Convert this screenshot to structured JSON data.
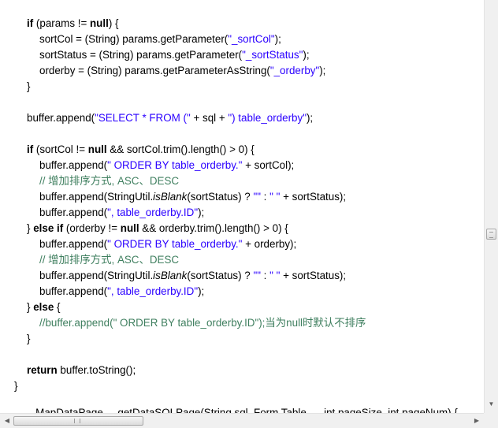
{
  "code": {
    "l1_kw_if": "if",
    "l1_a": " (params != ",
    "l1_kw_null": "null",
    "l1_b": ") {",
    "l2_a": "sortCol = (String) params.getParameter(",
    "l2_str": "\"_sortCol\"",
    "l2_b": ");",
    "l3_a": "sortStatus = (String) params.getParameter(",
    "l3_str": "\"_sortStatus\"",
    "l3_b": ");",
    "l4_a": "orderby = (String) params.getParameterAsString(",
    "l4_str": "\"_orderby\"",
    "l4_b": ");",
    "l5": "}",
    "l6_a": "buffer.append(",
    "l6_str1": "\"SELECT * FROM (\"",
    "l6_b": " + sql + ",
    "l6_str2": "\") table_orderby\"",
    "l6_c": ");",
    "l7_kw_if": "if",
    "l7_a": " (sortCol != ",
    "l7_kw_null": "null",
    "l7_b": " && sortCol.trim().length() > 0) {",
    "l8_a": "buffer.append(",
    "l8_str": "\" ORDER BY table_orderby.\"",
    "l8_b": " + sortCol);",
    "l9_cmt": "// 增加排序方式, ASC、DESC",
    "l10_a": "buffer.append(StringUtil.",
    "l10_it": "isBlank",
    "l10_b": "(sortStatus) ? ",
    "l10_str1": "\"\"",
    "l10_c": " : ",
    "l10_str2": "\" \"",
    "l10_d": " + sortStatus);",
    "l11_a": "buffer.append(",
    "l11_str": "\", table_orderby.ID\"",
    "l11_b": ");",
    "l12_a": "} ",
    "l12_kw_else": "else",
    "l12_sp": " ",
    "l12_kw_if": "if",
    "l12_b": " (orderby != ",
    "l12_kw_null": "null",
    "l12_c": " && orderby.trim().length() > 0) {",
    "l13_a": "buffer.append(",
    "l13_str": "\" ORDER BY table_orderby.\"",
    "l13_b": " + orderby);",
    "l14_cmt": "// 增加排序方式, ASC、DESC",
    "l15_a": "buffer.append(StringUtil.",
    "l15_it": "isBlank",
    "l15_b": "(sortStatus) ? ",
    "l15_str1": "\"\"",
    "l15_c": " : ",
    "l15_str2": "\" \"",
    "l15_d": " + sortStatus);",
    "l16_a": "buffer.append(",
    "l16_str": "\", table_orderby.ID\"",
    "l16_b": ");",
    "l17_a": "} ",
    "l17_kw_else": "else",
    "l17_b": " {",
    "l18_cmt": "//buffer.append(\" ORDER BY table_orderby.ID\");当为null时默认不排序",
    "l19": "}",
    "l20_kw_return": "return",
    "l20_a": " buffer.toString();",
    "l21": "}",
    "l22_partial": "...MapDataPage ... getDataSQLPage(String sql, Form Table ... ,int pageSize, int pageNum) {"
  },
  "scrollbars": {
    "down_arrow": "▼",
    "left_arrow": "◀",
    "right_arrow": "▶"
  }
}
